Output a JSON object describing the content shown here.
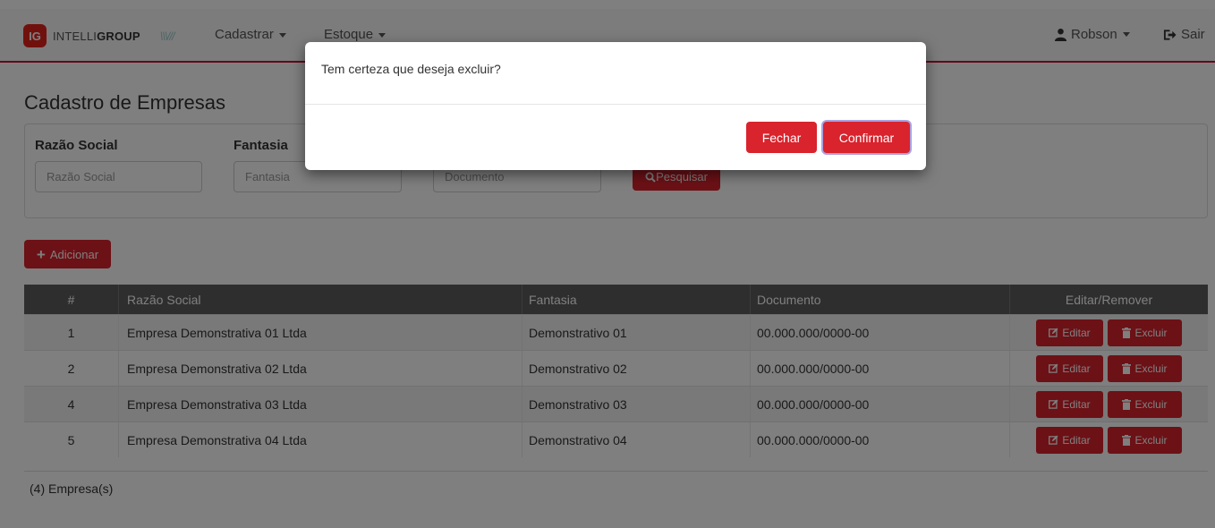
{
  "navbar": {
    "brand_badge": "IG",
    "brand_prefix": "INTELLI",
    "brand_suffix": "GROUP",
    "brand_mark": "\\\\\\///",
    "menu": [
      {
        "label": "Cadastrar",
        "icon": "caret-down-icon"
      },
      {
        "label": "Estoque",
        "icon": "caret-down-icon"
      }
    ],
    "user": {
      "icon": "user-icon",
      "label": "Robson"
    },
    "logout": {
      "icon": "sign-out-icon",
      "label": "Sair"
    },
    "accent_color": "#c8102e"
  },
  "page": {
    "title": "Cadastro de Empresas"
  },
  "filters": {
    "razao_social": {
      "label": "Razão Social",
      "placeholder": "Razão Social"
    },
    "fantasia": {
      "label": "Fantasia",
      "placeholder": "Fantasia"
    },
    "documento": {
      "placeholder": "Documento"
    },
    "search_button": {
      "icon": "search-icon",
      "label": "Pesquisar"
    }
  },
  "add_button": {
    "icon": "plus-icon",
    "label": "Adicionar"
  },
  "table": {
    "columns": [
      "#",
      "Razão Social",
      "Fantasia",
      "Documento",
      "Editar/Remover"
    ],
    "rows": [
      {
        "id": "1",
        "razao": "Empresa Demonstrativa 01 Ltda",
        "fantasia": "Demonstrativo 01",
        "documento": "00.000.000/0000-00"
      },
      {
        "id": "2",
        "razao": "Empresa Demonstrativa 02 Ltda",
        "fantasia": "Demonstrativo 02",
        "documento": "00.000.000/0000-00"
      },
      {
        "id": "4",
        "razao": "Empresa Demonstrativa 03 Ltda",
        "fantasia": "Demonstrativo 03",
        "documento": "00.000.000/0000-00"
      },
      {
        "id": "5",
        "razao": "Empresa Demonstrativa 04 Ltda",
        "fantasia": "Demonstrativo 04",
        "documento": "00.000.000/0000-00"
      }
    ],
    "edit_label": "Editar",
    "edit_icon": "edit-icon",
    "delete_label": "Excluir",
    "delete_icon": "trash-icon",
    "count_text": "(4) Empresa(s)"
  },
  "modal": {
    "message": "Tem certeza que deseja excluir?",
    "close_label": "Fechar",
    "confirm_label": "Confirmar",
    "button_color": "#d9232d"
  }
}
